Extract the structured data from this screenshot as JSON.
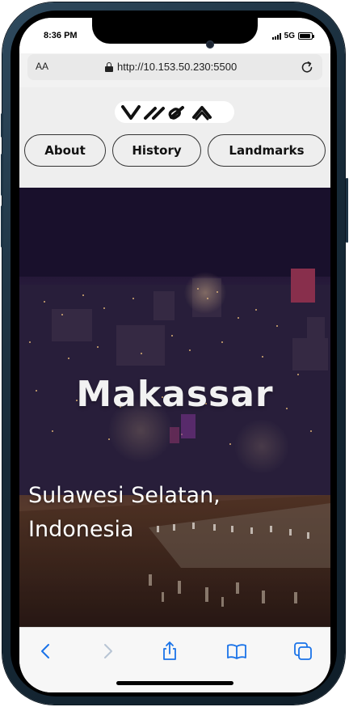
{
  "status_bar": {
    "time": "8:36 PM",
    "network": "5G",
    "battery_level": 0.9,
    "icons": [
      "signal-icon",
      "battery-icon"
    ]
  },
  "browser": {
    "text_size_label": "AA",
    "url": "http://10.153.50.230:5500",
    "icons": [
      "lock-icon",
      "reload-icon"
    ]
  },
  "header": {
    "logo": "VHOA",
    "nav": [
      {
        "label": "About"
      },
      {
        "label": "History"
      },
      {
        "label": "Landmarks"
      }
    ]
  },
  "hero": {
    "title": "Makassar",
    "subtitle": "Sulawesi Selatan, Indonesia"
  },
  "toolbar": {
    "icons": [
      "back-icon",
      "forward-icon",
      "share-icon",
      "bookmarks-icon",
      "tabs-icon"
    ],
    "accent": "#1a73e8",
    "disabled_color": "#b8c4d4"
  }
}
